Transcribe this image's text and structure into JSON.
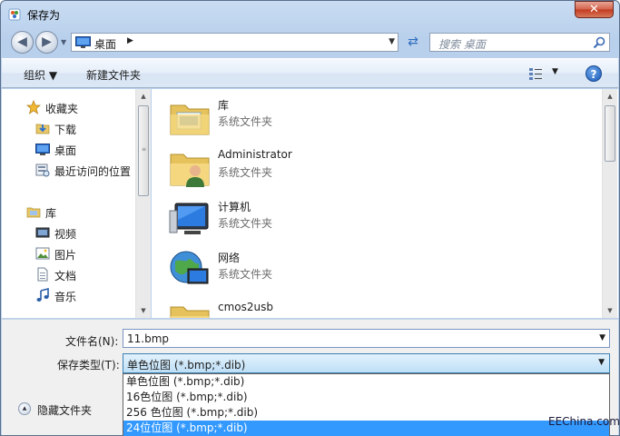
{
  "window": {
    "title": "保存为",
    "close_glyph": "✕"
  },
  "address": {
    "back_glyph": "◀",
    "forward_glyph": "▶",
    "location": "桌面",
    "arrow": "▶",
    "dropdown": "▼",
    "refresh_glyph": "⇄",
    "search_placeholder": "搜索 桌面"
  },
  "toolbar": {
    "organize": "组织 ▼",
    "new_folder": "新建文件夹",
    "view_dropdown": "▼",
    "help": "?"
  },
  "sidebar": {
    "favorites": {
      "label": "收藏夹",
      "icon": "star-icon"
    },
    "favorite_items": [
      {
        "label": "下载",
        "icon": "download-folder-icon"
      },
      {
        "label": "桌面",
        "icon": "desktop-icon"
      },
      {
        "label": "最近访问的位置",
        "icon": "recent-places-icon"
      }
    ],
    "libraries": {
      "label": "库",
      "icon": "library-icon"
    },
    "library_items": [
      {
        "label": "视频",
        "icon": "video-icon"
      },
      {
        "label": "图片",
        "icon": "pictures-icon"
      },
      {
        "label": "文档",
        "icon": "documents-icon"
      },
      {
        "label": "音乐",
        "icon": "music-icon"
      }
    ]
  },
  "files": [
    {
      "name": "库",
      "kind": "系统文件夹",
      "icon": "library-folder-icon"
    },
    {
      "name": "Administrator",
      "kind": "系统文件夹",
      "icon": "user-folder-icon"
    },
    {
      "name": "计算机",
      "kind": "系统文件夹",
      "icon": "computer-icon"
    },
    {
      "name": "网络",
      "kind": "系统文件夹",
      "icon": "network-icon"
    },
    {
      "name": "cmos2usb",
      "kind": "",
      "icon": "folder-icon"
    }
  ],
  "form": {
    "filename_label": "文件名(N):",
    "filename_value": "11.bmp",
    "type_label": "保存类型(T):",
    "type_value": "单色位图 (*.bmp;*.dib)",
    "dropdown_glyph": "▼",
    "type_options": [
      "单色位图 (*.bmp;*.dib)",
      "16色位图 (*.bmp;*.dib)",
      "256 色位图 (*.bmp;*.dib)",
      "24位位图 (*.bmp;*.dib)"
    ],
    "selected_option_index": 3,
    "hide_folders": "隐藏文件夹",
    "hide_glyph": "▲"
  },
  "watermark": "EEChina.com",
  "colors": {
    "selection": "#3399ff",
    "close": "#c2391f",
    "accent": "#1a58b5"
  }
}
